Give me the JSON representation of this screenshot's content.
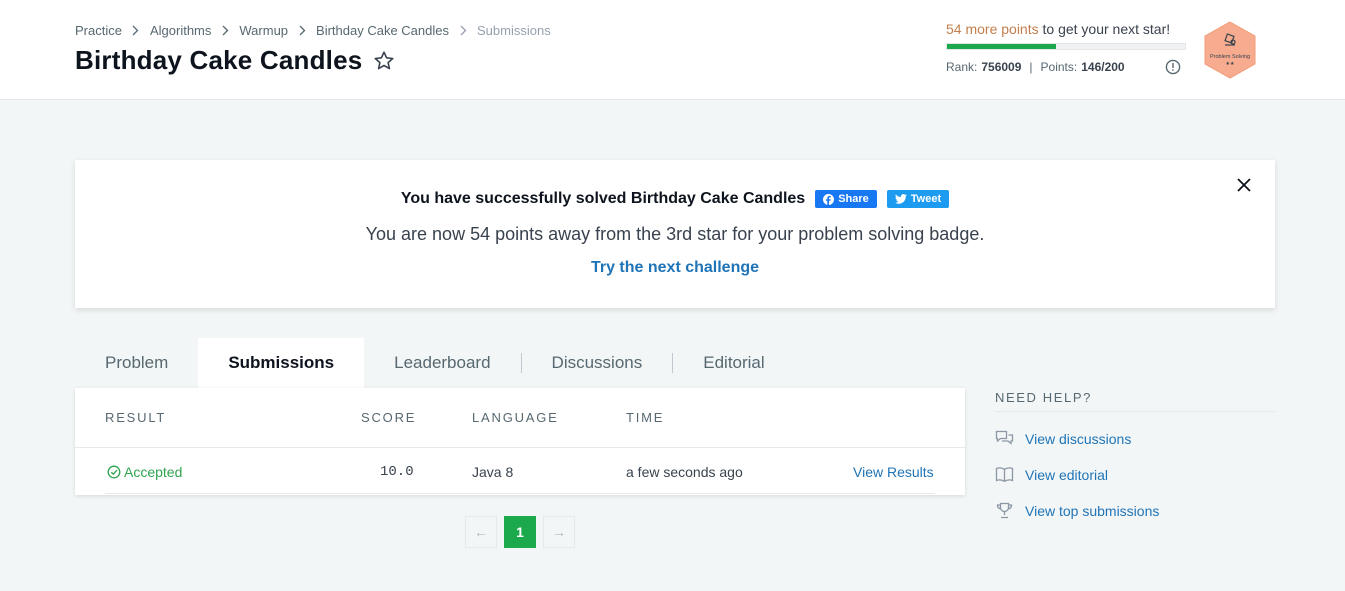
{
  "breadcrumb": [
    "Practice",
    "Algorithms",
    "Warmup",
    "Birthday Cake Candles",
    "Submissions"
  ],
  "title": "Birthday Cake Candles",
  "progress": {
    "points_text": "54 more points",
    "suffix_text": " to get your next star!",
    "fraction": 0.46,
    "rank_label": "Rank:",
    "rank_value": "756009",
    "points_label": "Points:",
    "points_value": "146/200",
    "badge_label": "Problem Solving",
    "badge_stars": "★★",
    "bar_color": "#1ba94c",
    "badge_color": "#f7ac8f"
  },
  "banner": {
    "solved_text": "You have successfully solved Birthday Cake Candles",
    "share_label": "Share",
    "tweet_label": "Tweet",
    "message": "You are now 54 points away from the 3rd star for your problem solving badge.",
    "next_link": "Try the next challenge"
  },
  "tabs": [
    "Problem",
    "Submissions",
    "Leaderboard",
    "Discussions",
    "Editorial"
  ],
  "active_tab": "Submissions",
  "table": {
    "headers": [
      "RESULT",
      "SCORE",
      "LANGUAGE",
      "TIME"
    ],
    "rows": [
      {
        "result": "Accepted",
        "score": "10.0",
        "language": "Java 8",
        "time": "a few seconds ago",
        "action": "View Results"
      }
    ]
  },
  "pagination": {
    "prev": "←",
    "current": "1",
    "next": "→"
  },
  "help": {
    "title": "NEED HELP?",
    "links": [
      "View discussions",
      "View editorial",
      "View top submissions"
    ]
  },
  "colors": {
    "accent_green": "#1ba94c",
    "link_blue": "#1f74b7",
    "accepted_green": "#2ea44f"
  }
}
